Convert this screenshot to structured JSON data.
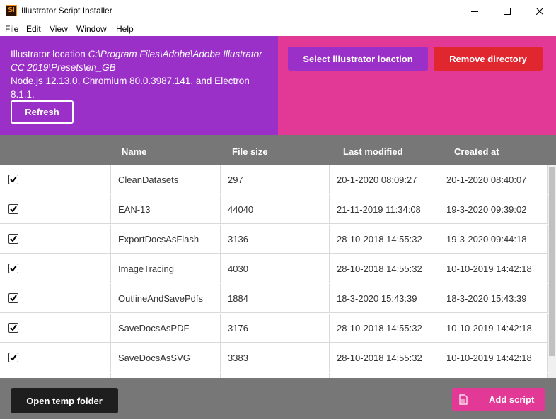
{
  "window": {
    "app_icon_text": "SI",
    "title": "Illustrator Script Installer",
    "controls": [
      "minimize-icon",
      "maximize-icon",
      "close-icon"
    ]
  },
  "menu": [
    "File",
    "Edit",
    "View",
    "Window",
    "Help"
  ],
  "info": {
    "location_label": "Illustrator location ",
    "location_path": "C:\\Program Files\\Adobe\\Adobe Illustrator CC 2019\\Presets\\en_GB",
    "versions": "Node.js 12.13.0, Chromium 80.0.3987.141, and Electron 8.1.1.",
    "refresh_label": "Refresh"
  },
  "actions": {
    "select_label": "Select illustrator loaction",
    "remove_label": "Remove directory"
  },
  "table": {
    "columns": [
      "",
      "Name",
      "File size",
      "Last modified",
      "Created at"
    ],
    "rows": [
      {
        "checked": true,
        "name": "CleanDatasets",
        "size": "297",
        "modified": "20-1-2020 08:09:27",
        "created": "20-1-2020 08:40:07"
      },
      {
        "checked": true,
        "name": "EAN-13",
        "size": "44040",
        "modified": "21-11-2019 11:34:08",
        "created": "19-3-2020 09:39:02"
      },
      {
        "checked": true,
        "name": "ExportDocsAsFlash",
        "size": "3136",
        "modified": "28-10-2018 14:55:32",
        "created": "19-3-2020 09:44:18"
      },
      {
        "checked": true,
        "name": "ImageTracing",
        "size": "4030",
        "modified": "28-10-2018 14:55:32",
        "created": "10-10-2019 14:42:18"
      },
      {
        "checked": true,
        "name": "OutlineAndSavePdfs",
        "size": "1884",
        "modified": "18-3-2020 15:43:39",
        "created": "18-3-2020 15:43:39"
      },
      {
        "checked": true,
        "name": "SaveDocsAsPDF",
        "size": "3176",
        "modified": "28-10-2018 14:55:32",
        "created": "10-10-2019 14:42:18"
      },
      {
        "checked": true,
        "name": "SaveDocsAsSVG",
        "size": "3383",
        "modified": "28-10-2018 14:55:32",
        "created": "10-10-2019 14:42:18"
      }
    ]
  },
  "footer": {
    "temp_label": "Open temp folder",
    "add_label": "Add script",
    "add_icon": "file-icon"
  },
  "colors": {
    "purple": "#9b30c8",
    "pink": "#e23896",
    "red": "#e0262e",
    "gray": "#777777",
    "dark": "#1e1e1e"
  }
}
